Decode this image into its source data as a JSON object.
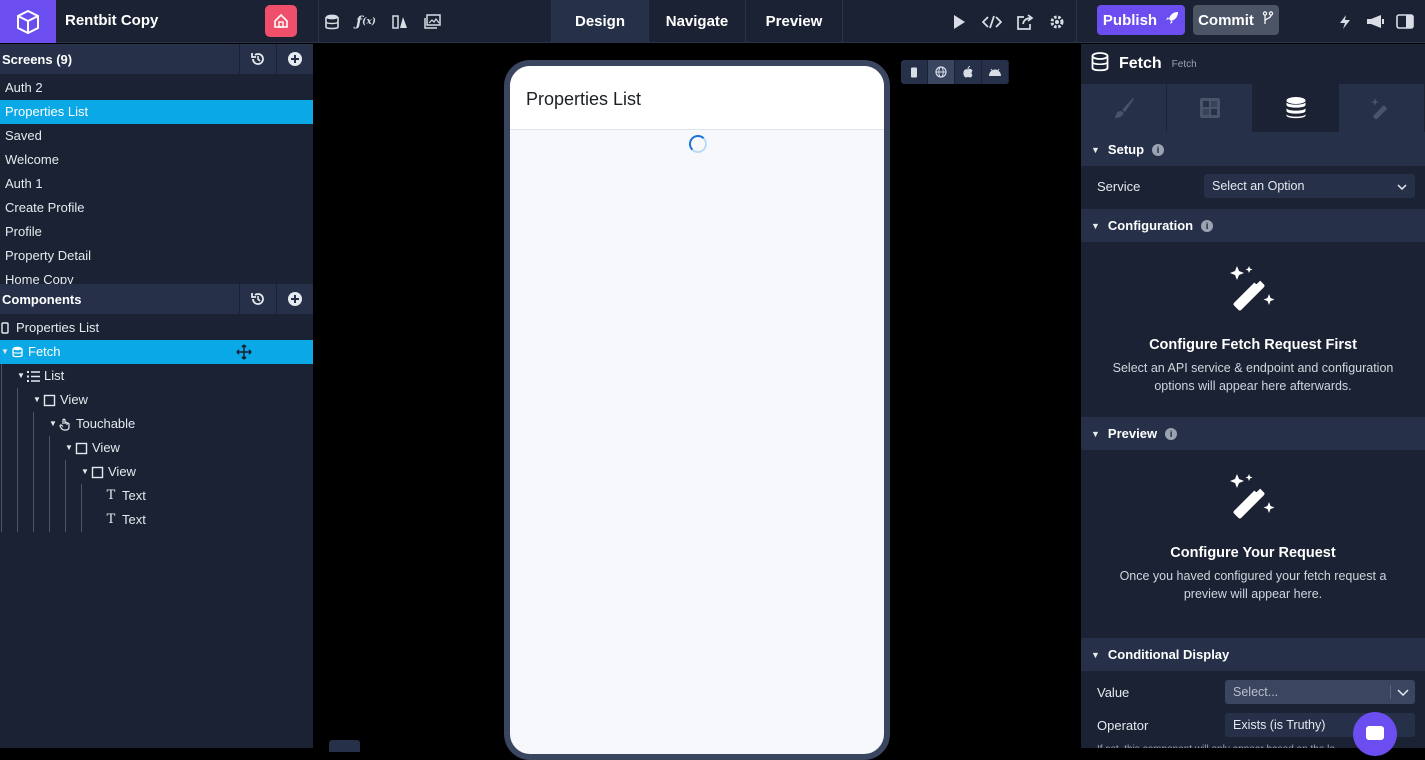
{
  "app": {
    "title": "Rentbit Copy"
  },
  "modes": [
    "Design",
    "Navigate",
    "Preview"
  ],
  "actions": {
    "publish": "Publish",
    "commit": "Commit"
  },
  "screens": {
    "title": "Screens (9)",
    "items": [
      "Auth 2",
      "Properties List",
      "Saved",
      "Welcome",
      "Auth 1",
      "Create Profile",
      "Profile",
      "Property Detail",
      "Home Copy"
    ],
    "selected": "Properties List"
  },
  "components": {
    "title": "Components",
    "tree": [
      {
        "label": "Properties List",
        "icon": "screen-icon",
        "depth": 0,
        "caret": false
      },
      {
        "label": "Fetch",
        "icon": "database-icon",
        "depth": 0,
        "caret": true,
        "selected": true
      },
      {
        "label": "List",
        "icon": "list-icon",
        "depth": 1,
        "caret": true
      },
      {
        "label": "View",
        "icon": "view-icon",
        "depth": 2,
        "caret": true
      },
      {
        "label": "Touchable",
        "icon": "touch-icon",
        "depth": 3,
        "caret": true
      },
      {
        "label": "View",
        "icon": "view-icon",
        "depth": 4,
        "caret": true
      },
      {
        "label": "View",
        "icon": "view-icon",
        "depth": 5,
        "caret": true
      },
      {
        "label": "Text",
        "icon": "text-icon",
        "depth": 6,
        "caret": false
      },
      {
        "label": "Text",
        "icon": "text-icon",
        "depth": 6,
        "caret": false
      }
    ]
  },
  "device": {
    "screen_title": "Properties List"
  },
  "inspector": {
    "name": "Fetch",
    "type": "Fetch",
    "setup": {
      "title": "Setup",
      "service_label": "Service",
      "service_value": "Select an Option"
    },
    "configuration": {
      "title": "Configuration",
      "empty_title": "Configure Fetch Request First",
      "empty_desc": "Select an API service & endpoint and configuration options will appear here afterwards."
    },
    "preview": {
      "title": "Preview",
      "empty_title": "Configure Your Request",
      "empty_desc": "Once you haved configured your fetch request a preview will appear here."
    },
    "conditional": {
      "title": "Conditional Display",
      "value_label": "Value",
      "value_placeholder": "Select...",
      "operator_label": "Operator",
      "operator_value": "Exists (is Truthy)",
      "note": "If set, this component will only appear based on the lo"
    }
  },
  "colors": {
    "accent": "#6c4ef0",
    "selection": "#0aa8e6",
    "panel": "#1a2233",
    "header": "#263149",
    "home": "#ef4f6b"
  }
}
